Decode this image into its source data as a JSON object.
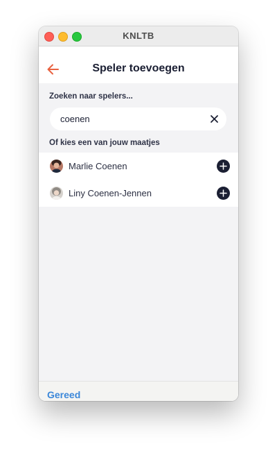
{
  "window": {
    "title": "KNLTB"
  },
  "nav": {
    "title": "Speler toevoegen",
    "back_icon": "arrow-left-icon",
    "accent_color": "#e8613f"
  },
  "search": {
    "label": "Zoeken naar spelers...",
    "value": "coenen",
    "clear_icon": "close-icon"
  },
  "buddies": {
    "label": "Of kies een van jouw maatjes",
    "players": [
      {
        "name": "Marlie Coenen",
        "avatar_icon": "avatar-photo-icon",
        "add_icon": "plus-circle-icon"
      },
      {
        "name": "Liny Coenen-Jennen",
        "avatar_icon": "avatar-photo-icon",
        "add_icon": "plus-circle-icon"
      }
    ]
  },
  "footer": {
    "done_label": "Gereed",
    "done_color": "#3b87d9"
  }
}
